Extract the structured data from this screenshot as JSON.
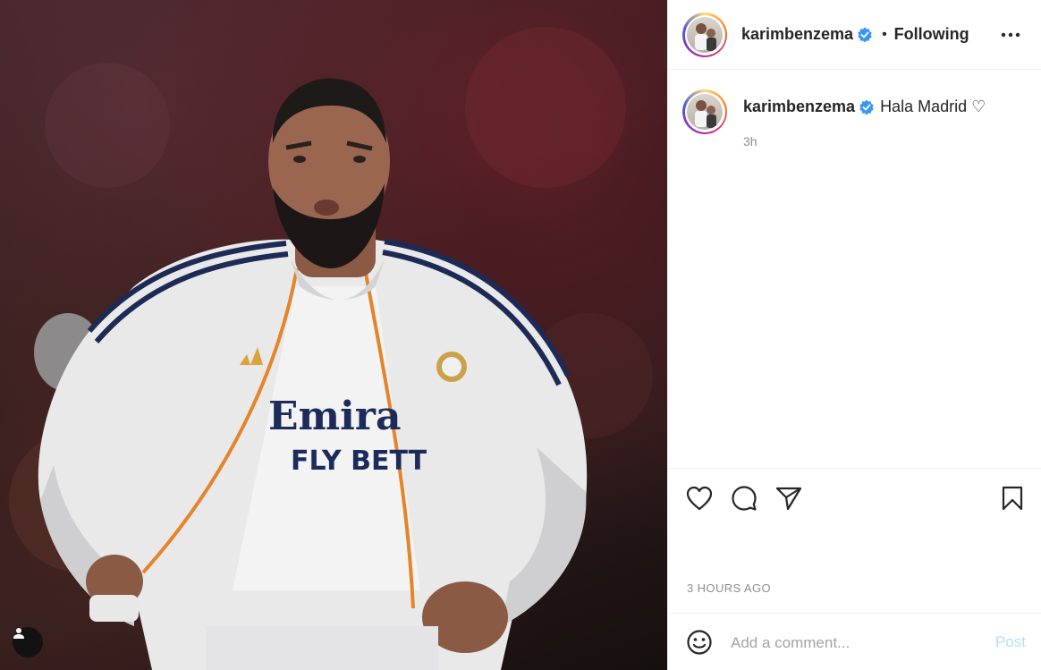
{
  "post": {
    "author": {
      "username": "karimbenzema",
      "verified": true
    },
    "follow_status": "Following",
    "separator": "•",
    "caption": {
      "username": "karimbenzema",
      "text": "Hala Madrid ♡",
      "time_ago": "3h"
    },
    "timestamp": "3 HOURS AGO",
    "photo": {
      "jersey_text_line1": "Emira",
      "jersey_text_line2": "FLY BETT"
    }
  },
  "comment": {
    "placeholder": "Add a comment...",
    "post_label": "Post"
  },
  "icons": {
    "like": "heart-icon",
    "comment": "comment-bubble-icon",
    "share": "paper-plane-icon",
    "save": "bookmark-icon",
    "more": "more-options-icon",
    "emoji": "emoji-smile-icon",
    "tags": "user-tag-icon"
  },
  "colors": {
    "verified": "#3897f0",
    "post_disabled": "#b2dffc",
    "muted": "#8e8e8e"
  }
}
